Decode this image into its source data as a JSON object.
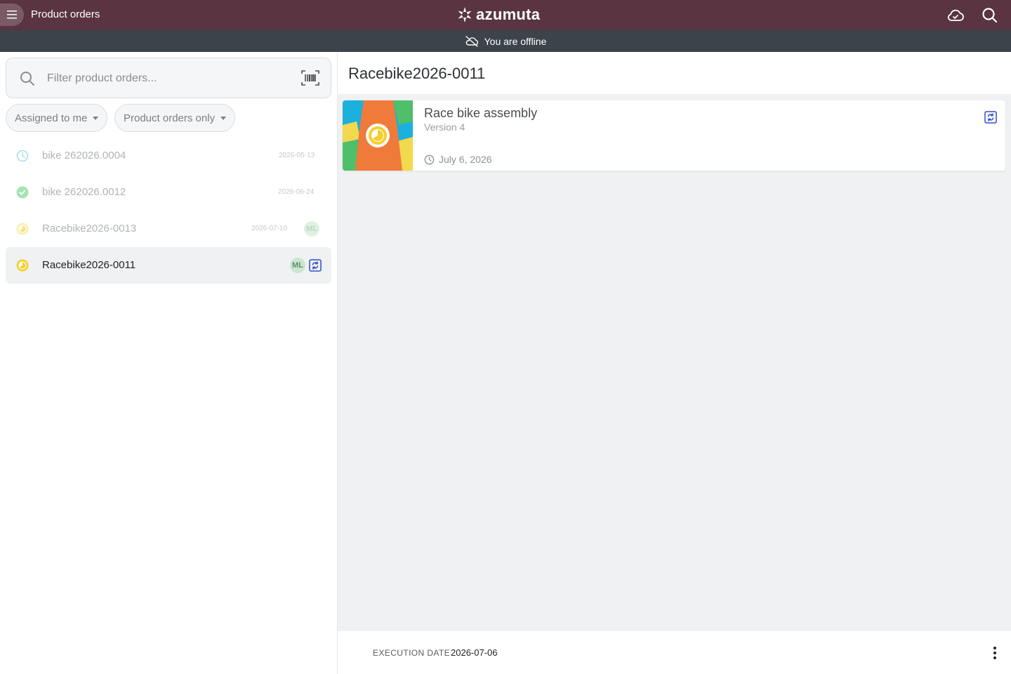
{
  "header": {
    "app_title": "Product orders",
    "logo_text": "azumuta"
  },
  "banner": {
    "offline_text": "You are offline"
  },
  "search": {
    "placeholder": "Filter product orders..."
  },
  "filters": [
    {
      "label": "Assigned to me"
    },
    {
      "label": "Product orders only"
    }
  ],
  "orders": [
    {
      "name": "bike 262026.0004",
      "date": "2026-05-13",
      "status": "scheduled-clock-icon",
      "assignee": "",
      "selected": false
    },
    {
      "name": "bike 262026.0012",
      "date": "2026-06-24",
      "status": "completed-check-icon",
      "assignee": "",
      "selected": false
    },
    {
      "name": "Racebike2026-0013",
      "date": "2026-07-10",
      "status": "in-progress-icon",
      "assignee": "ML",
      "selected": false
    },
    {
      "name": "Racebike2026-0011",
      "date": "",
      "status": "in-progress-icon",
      "assignee": "ML",
      "selected": true
    }
  ],
  "detail": {
    "title": "Racebike2026-0011",
    "card": {
      "title": "Race bike assembly",
      "version": "Version 4",
      "date": "July 6, 2026"
    },
    "footer": {
      "exec_label": "EXECUTION DATE",
      "exec_value": "2026-07-06"
    }
  },
  "colors": {
    "topbar": "#5a3441",
    "offline_banner": "#3c434b",
    "accent_blue": "#2f4ec9",
    "in_progress": "#f5cf2a",
    "done_green": "#5ccf72",
    "scheduled_blue": "#6cc4ec"
  }
}
